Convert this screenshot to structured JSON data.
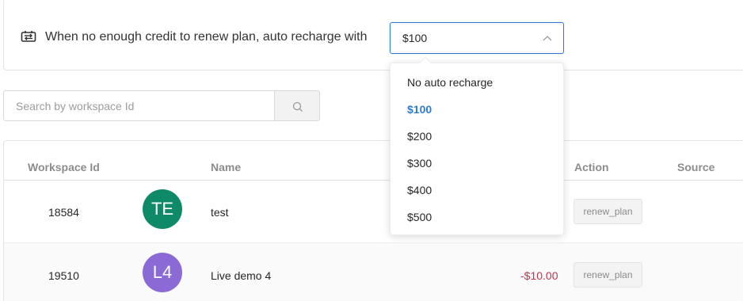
{
  "auto_recharge": {
    "label": "When no enough credit to renew plan, auto recharge with",
    "selected": "$100",
    "options": [
      {
        "label": "No auto recharge",
        "selected": false
      },
      {
        "label": "$100",
        "selected": true
      },
      {
        "label": "$200",
        "selected": false
      },
      {
        "label": "$300",
        "selected": false
      },
      {
        "label": "$400",
        "selected": false
      },
      {
        "label": "$500",
        "selected": false
      }
    ],
    "icon": "renew-icon"
  },
  "search": {
    "placeholder": "Search by workspace Id",
    "value": "",
    "icon": "search-icon"
  },
  "table": {
    "columns": {
      "workspace_id": "Workspace Id",
      "name": "Name",
      "action": "Action",
      "source": "Source"
    },
    "rows": [
      {
        "workspace_id": "18584",
        "avatar_initials": "TE",
        "avatar_color": "#0f8a68",
        "name": "test",
        "amount": "",
        "action": "renew_plan",
        "source": ""
      },
      {
        "workspace_id": "19510",
        "avatar_initials": "L4",
        "avatar_color": "#8b6ad6",
        "name": "Live demo 4",
        "amount": "-$10.00",
        "action": "renew_plan",
        "source": ""
      }
    ]
  },
  "colors": {
    "accent": "#2d7bd8",
    "negative_amount": "#c0334f"
  }
}
